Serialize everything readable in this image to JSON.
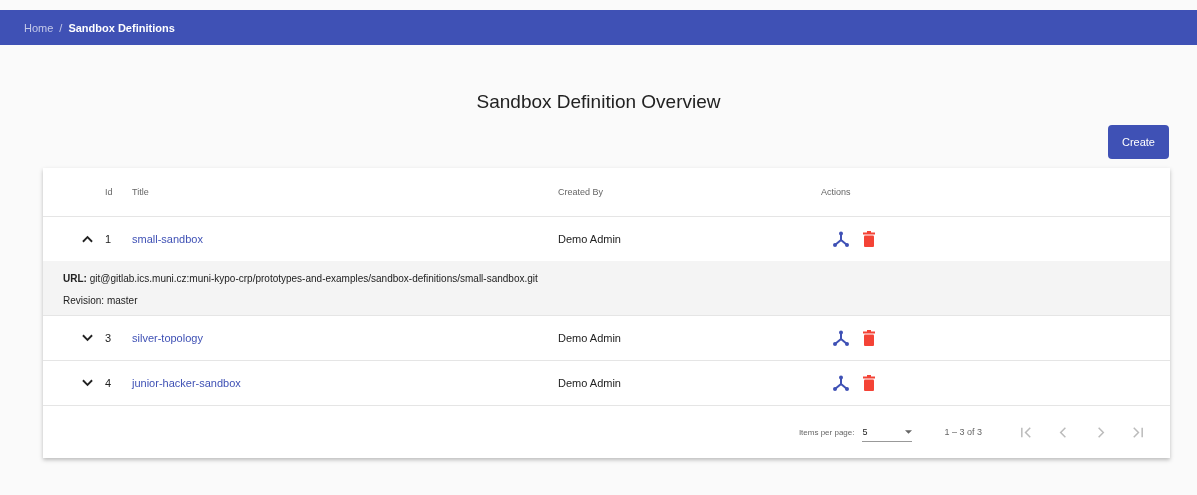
{
  "breadcrumb": [
    {
      "label": "Home",
      "current": false
    },
    {
      "label": "Sandbox Definitions",
      "current": true
    }
  ],
  "breadcrumb_separator": "/",
  "title": "Sandbox Definition Overview",
  "create_button": "Create",
  "table": {
    "columns": [
      "Id",
      "Title",
      "Created By",
      "Actions"
    ],
    "rows": [
      {
        "id": "1",
        "title": "small-sandbox",
        "created_by": "Demo Admin",
        "expanded": true,
        "details": [
          "**URL:** git@gitlab.ics.muni.cz:muni-kypo-crp/prototypes-and-examples/sandbox-definitions/small-sandbox.git",
          "Revision: master"
        ]
      },
      {
        "id": "3",
        "title": "silver-topology",
        "created_by": "Demo Admin",
        "expanded": false
      },
      {
        "id": "4",
        "title": "junior-hacker-sandbox",
        "created_by": "Demo Admin",
        "expanded": false
      }
    ]
  },
  "paginator": {
    "items_per_page_label": "Items per page:",
    "items_per_page": "5",
    "range": "1 – 3 of 3",
    "buttons": [
      {
        "kind": "first",
        "disabled": true
      },
      {
        "kind": "prev",
        "disabled": true
      },
      {
        "kind": "next",
        "disabled": true
      },
      {
        "kind": "last",
        "disabled": true
      }
    ]
  }
}
